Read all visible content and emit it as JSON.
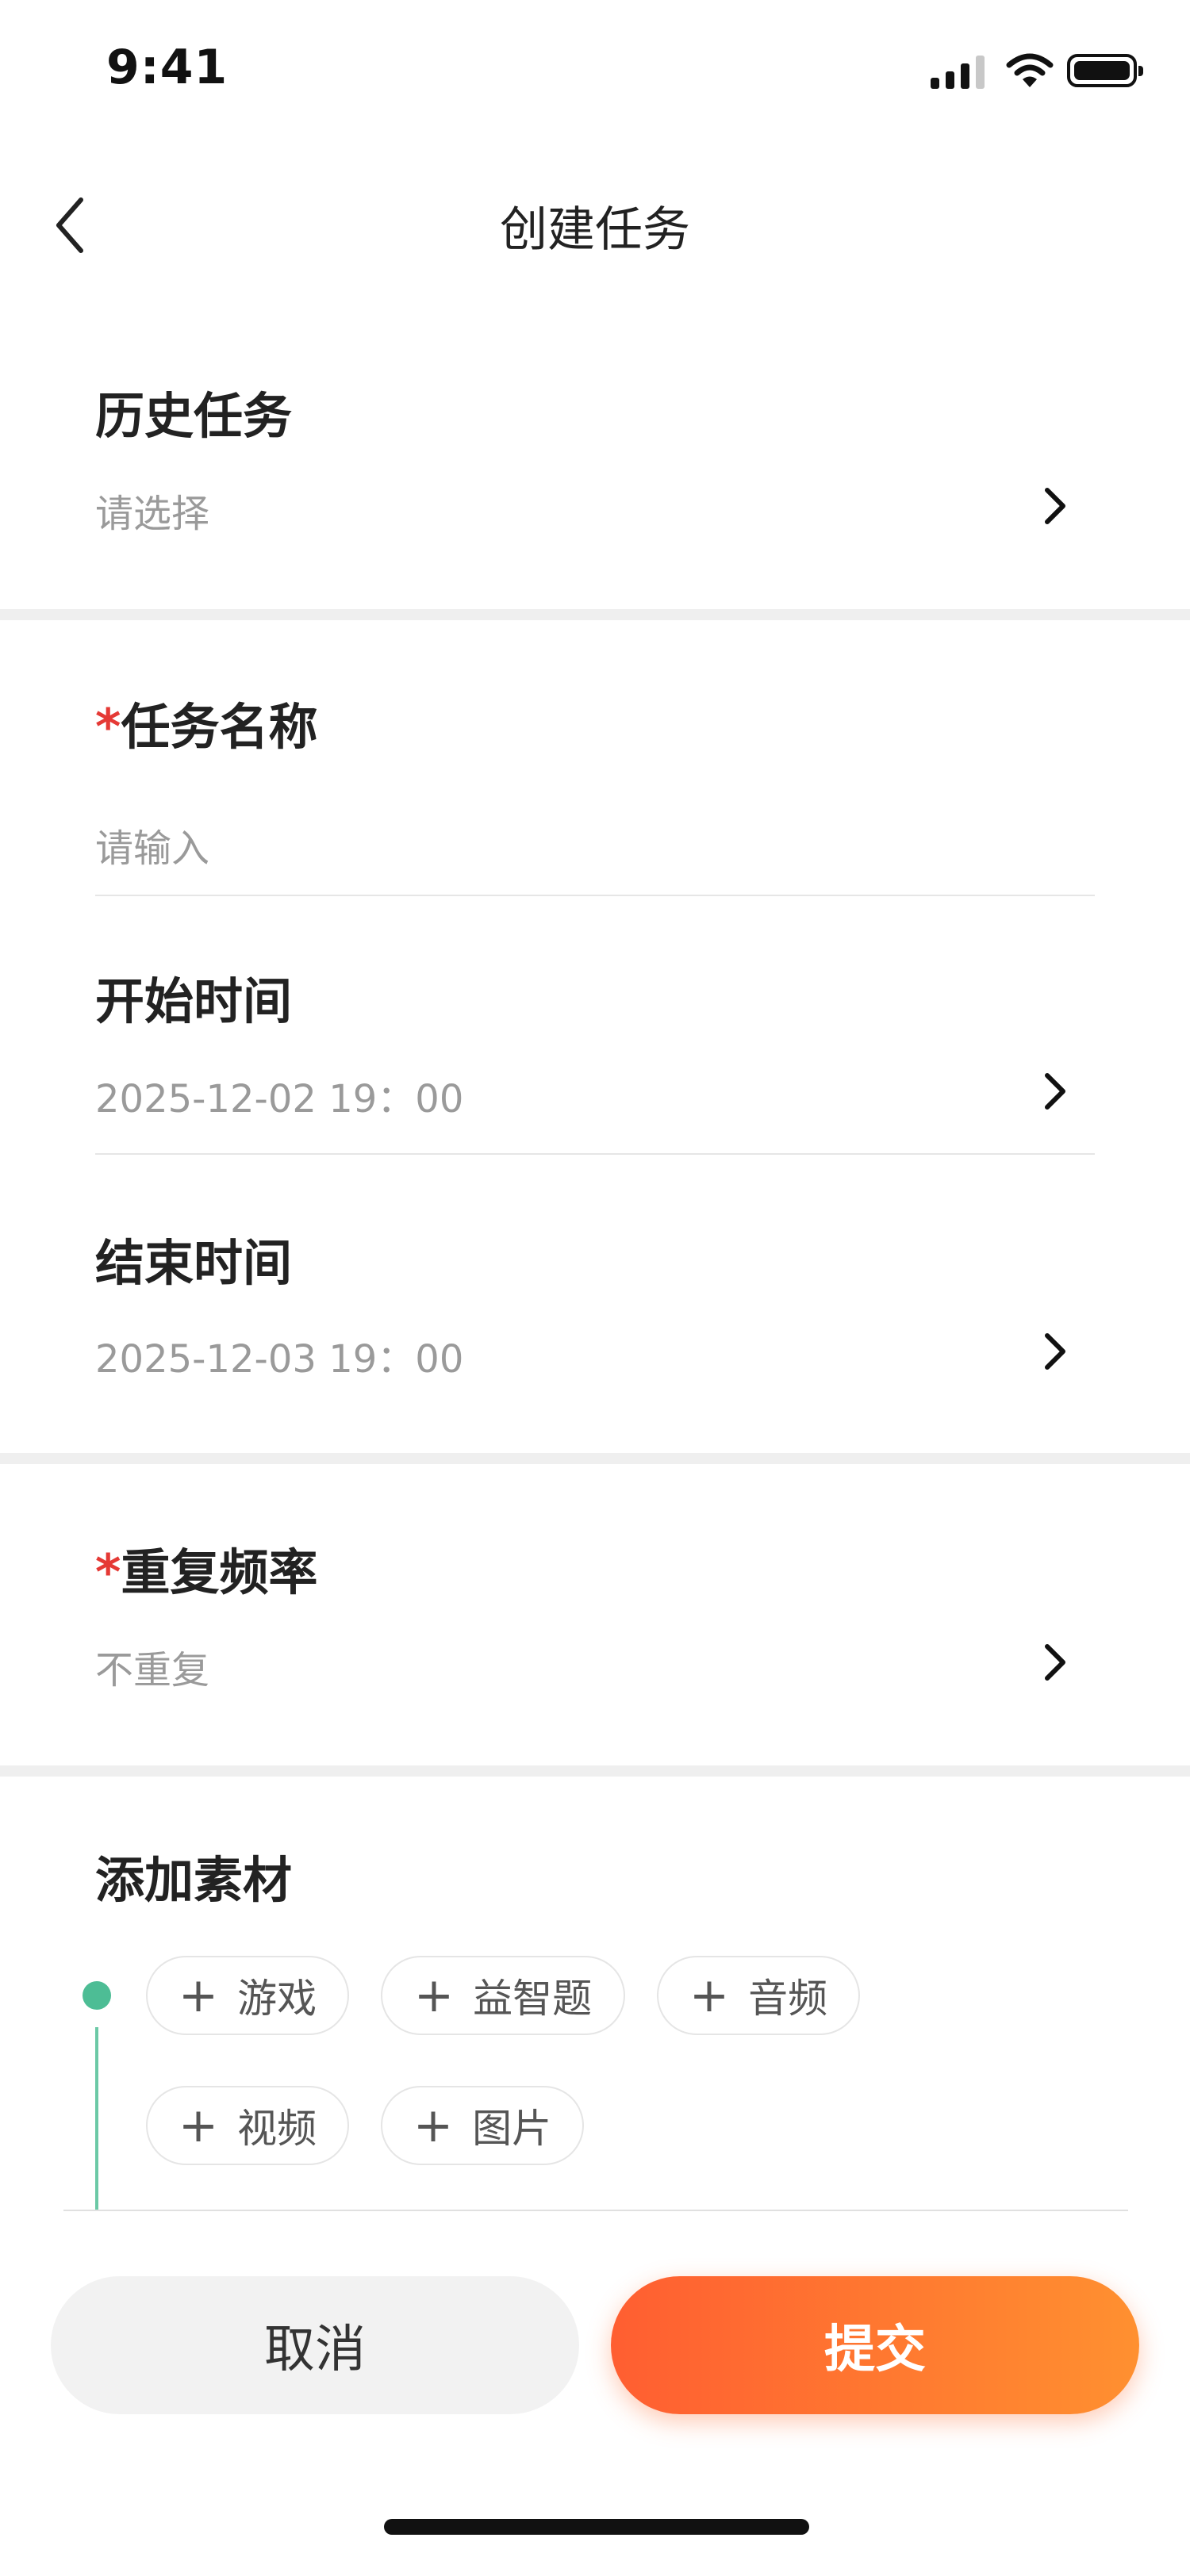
{
  "status_bar": {
    "time": "9:41"
  },
  "nav": {
    "title": "创建任务"
  },
  "history": {
    "label": "历史任务",
    "value": "请选择"
  },
  "task_name": {
    "required_mark": "*",
    "label": "任务名称",
    "placeholder": "请输入"
  },
  "start_time": {
    "label": "开始时间",
    "value": "2025-12-02 19：00"
  },
  "end_time": {
    "label": "结束时间",
    "value": "2025-12-03 19：00"
  },
  "repeat": {
    "required_mark": "*",
    "label": "重复频率",
    "value": "不重复"
  },
  "materials": {
    "label": "添加素材",
    "chips": [
      "游戏",
      "益智题",
      "音频",
      "视频",
      "图片"
    ]
  },
  "actions": {
    "cancel": "取消",
    "submit": "提交"
  },
  "colors": {
    "accent_start": "#ff5e31",
    "accent_end": "#ff9030",
    "timeline": "#4dbd95",
    "required": "#e53935"
  }
}
